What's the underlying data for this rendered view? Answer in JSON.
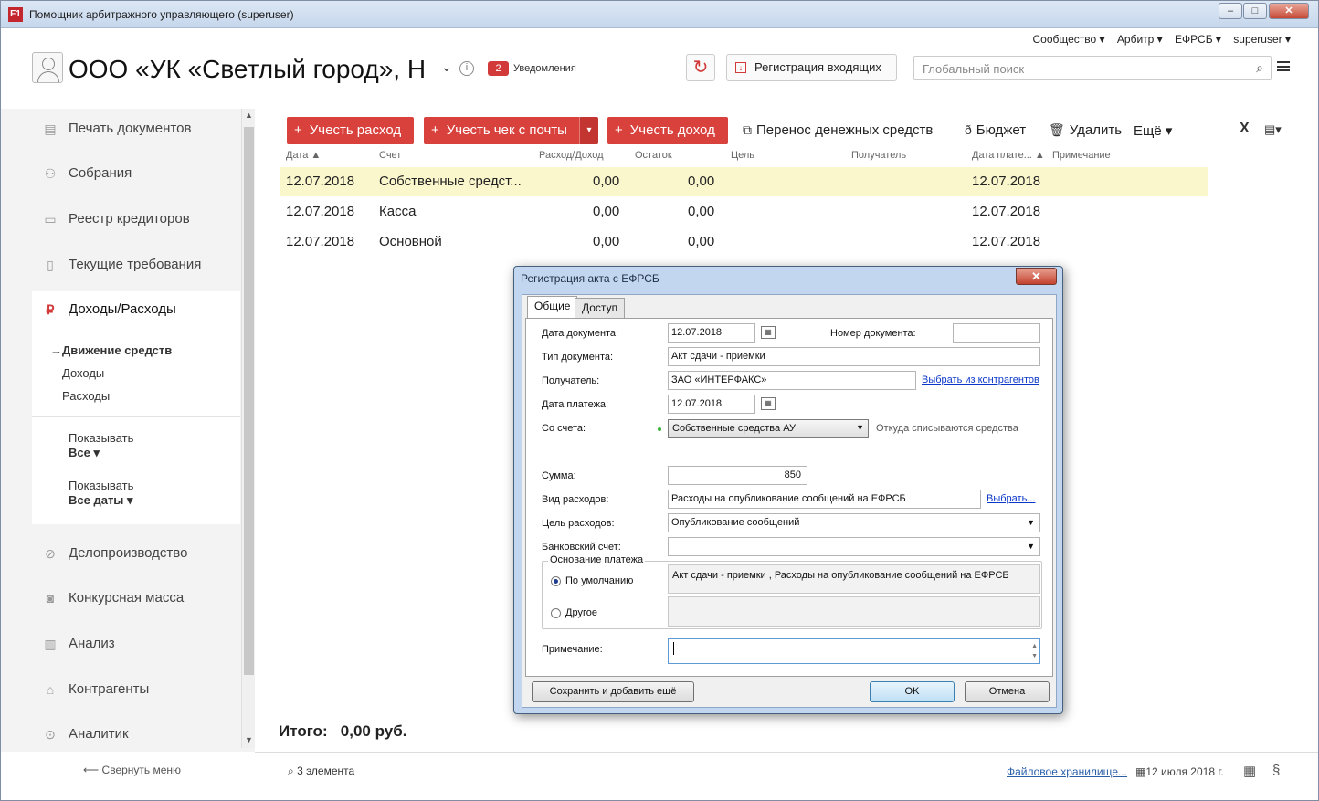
{
  "window": {
    "title": "Помощник арбитражного управляющего (superuser)",
    "app_icon": "F1",
    "min": "–",
    "max": "□",
    "close": "✕"
  },
  "topnav": [
    "Сообщество ▾",
    "Арбитр ▾",
    "ЕФРСБ ▾",
    "superuser ▾"
  ],
  "header": {
    "org_name": "ООО «УК «Светлый город», Н",
    "notifications_count": "2",
    "notifications_label": "Уведомления",
    "register_incoming": "Регистрация входящих",
    "search_placeholder": "Глобальный поиск"
  },
  "sidebar": {
    "items": [
      {
        "label": "Печать документов",
        "icon": "document-icon"
      },
      {
        "label": "Собрания",
        "icon": "handshake-icon"
      },
      {
        "label": "Реестр кредиторов",
        "icon": "id-card-icon"
      },
      {
        "label": "Текущие требования",
        "icon": "clipboard-icon"
      },
      {
        "label": "Доходы/Расходы",
        "icon": "ruble-icon"
      },
      {
        "label": "Делопроизводство",
        "icon": "paperclip-icon"
      },
      {
        "label": "Конкурсная масса",
        "icon": "bag-icon"
      },
      {
        "label": "Анализ",
        "icon": "bar-chart-icon"
      },
      {
        "label": "Контрагенты",
        "icon": "bank-icon"
      },
      {
        "label": "Аналитик",
        "icon": "magnifier-chart-icon"
      }
    ],
    "sub": {
      "active": "Движение средств",
      "income": "Доходы",
      "expense": "Расходы"
    },
    "filter1": {
      "label": "Показывать",
      "value": "Все ▾"
    },
    "filter2": {
      "label": "Показывать",
      "value": "Все даты ▾"
    },
    "collapse": "Свернуть меню"
  },
  "toolbar": {
    "expense": "Учесть расход",
    "check_mail": "Учесть чек с почты",
    "income": "Учесть доход",
    "transfer": "Перенос денежных средств",
    "budget": "Бюджет",
    "delete": "Удалить",
    "more": "Ещё ▾"
  },
  "table": {
    "headers": [
      "Дата ▲",
      "Счет",
      "Расход/Доход",
      "Остаток",
      "Цель",
      "Получатель",
      "Дата плате... ▲",
      "Примечание"
    ],
    "rows": [
      {
        "date": "12.07.2018",
        "account": "Собственные средст...",
        "amount": "0,00",
        "balance": "0,00",
        "paydate": "12.07.2018"
      },
      {
        "date": "12.07.2018",
        "account": "Касса",
        "amount": "0,00",
        "balance": "0,00",
        "paydate": "12.07.2018"
      },
      {
        "date": "12.07.2018",
        "account": "Основной",
        "amount": "0,00",
        "balance": "0,00",
        "paydate": "12.07.2018"
      }
    ]
  },
  "total": {
    "label": "Итого:",
    "value": "0,00 руб."
  },
  "status": {
    "count": "3 элемента",
    "files": "Файловое хранилище...",
    "date": "12 июля 2018 г."
  },
  "dialog": {
    "title": "Регистрация акта с ЕФРСБ",
    "tabs": [
      "Общие",
      "Доступ"
    ],
    "doc_date_label": "Дата документа:",
    "doc_date": "12.07.2018",
    "doc_number_label": "Номер документа:",
    "doc_number": "",
    "doc_type_label": "Тип документа:",
    "doc_type": "Акт сдачи - приемки",
    "recipient_label": "Получатель:",
    "recipient": "ЗАО «ИНТЕРФАКС»",
    "choose_counterparty": "Выбрать из контрагентов",
    "pay_date_label": "Дата платежа:",
    "pay_date": "12.07.2018",
    "from_account_label": "Со счета:",
    "from_account": "Собственные средства АУ",
    "from_hint": "Откуда списываются средства",
    "sum_label": "Сумма:",
    "sum": "850",
    "expense_type_label": "Вид расходов:",
    "expense_type": "Расходы на опубликование сообщений на ЕФРСБ",
    "choose": "Выбрать...",
    "expense_goal_label": "Цель расходов:",
    "expense_goal": "Опубликование сообщений",
    "bank_account_label": "Банковский счет:",
    "bank_account": "",
    "basis_group": "Основание платежа",
    "basis_default": "По умолчанию",
    "basis_default_text": "Акт сдачи - приемки , Расходы на опубликование сообщений на ЕФРСБ",
    "basis_other": "Другое",
    "note_label": "Примечание:",
    "save_add": "Сохранить и добавить ещё",
    "ok": "OK",
    "cancel": "Отмена"
  }
}
